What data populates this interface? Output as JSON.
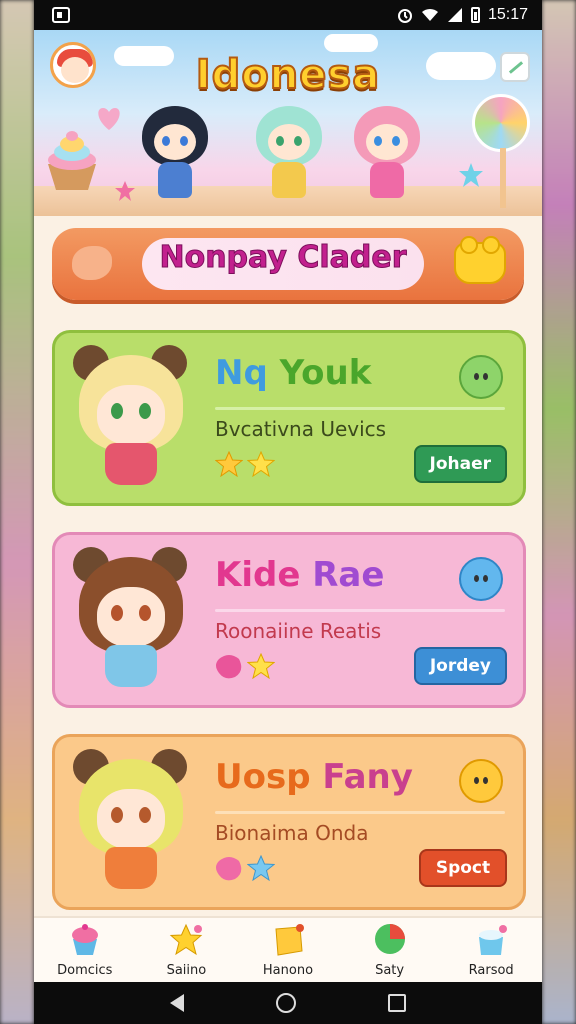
{
  "status_bar": {
    "time": "15:17"
  },
  "banner": {
    "title": "Idonesa"
  },
  "section": {
    "title": "Nonpay Clader"
  },
  "cards": [
    {
      "title": "Nq Youk",
      "subtitle": "Bvcativna Uevics",
      "action": "Johaer",
      "colors": {
        "bg": "#b9de6a",
        "border": "#8fbf3e",
        "title": "#3f9be0",
        "title2": "#4aa62b",
        "action": "#2f9a55"
      }
    },
    {
      "title": "Kide Rae",
      "subtitle": "Roonaiine Reatis",
      "action": "Jordey",
      "colors": {
        "bg": "#f7b8d6",
        "border": "#e38ab7",
        "title": "#e2378f",
        "title2": "#a04bd1",
        "action": "#3d8fd6"
      }
    },
    {
      "title": "Uosp Fany",
      "subtitle": "Bionaima Onda",
      "action": "Spoct",
      "colors": {
        "bg": "#fbc98a",
        "border": "#eaa45a",
        "title": "#e76a1c",
        "title2": "#c9408e",
        "action": "#e2502a"
      }
    }
  ],
  "bottom_nav": [
    {
      "label": "Domcics",
      "icon": "cupcake-icon"
    },
    {
      "label": "Saiino",
      "icon": "star-icon"
    },
    {
      "label": "Hanono",
      "icon": "sticky-note-icon"
    },
    {
      "label": "Saty",
      "icon": "balloon-icon"
    },
    {
      "label": "Rarsod",
      "icon": "gift-box-icon"
    }
  ]
}
